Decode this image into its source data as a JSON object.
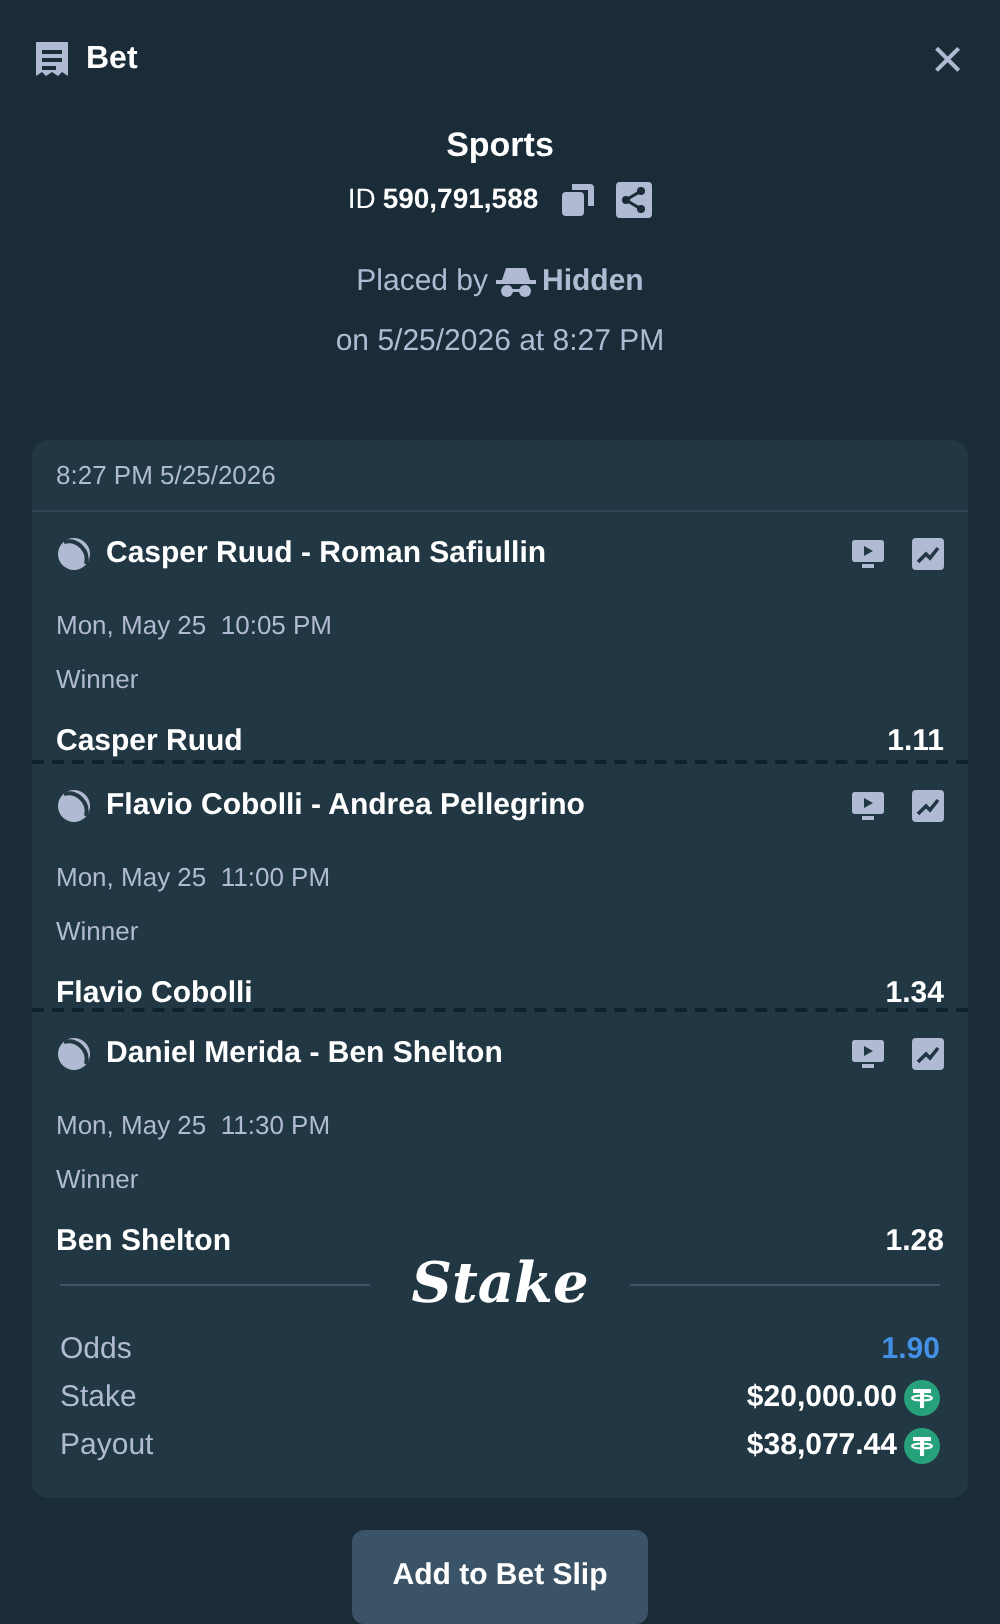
{
  "header": {
    "title": "Bet",
    "close": "×"
  },
  "bet": {
    "category": "Sports",
    "id_label": "ID",
    "id": "590,791,588",
    "placed_by_label": "Placed by",
    "placed_by": "Hidden",
    "placed_on": "on 5/25/2026 at 8:27 PM"
  },
  "slip": {
    "timestamp": "8:27 PM 5/25/2026",
    "legs": [
      {
        "match": "Casper Ruud - Roman Safiullin",
        "time": "Mon, May 25  10:05 PM",
        "market": "Winner",
        "selection": "Casper Ruud",
        "odds": "1.11"
      },
      {
        "match": "Flavio Cobolli - Andrea Pellegrino",
        "time": "Mon, May 25  11:00 PM",
        "market": "Winner",
        "selection": "Flavio Cobolli",
        "odds": "1.34"
      },
      {
        "match": "Daniel Merida - Ben Shelton",
        "time": "Mon, May 25  11:30 PM",
        "market": "Winner",
        "selection": "Ben Shelton",
        "odds": "1.28"
      }
    ],
    "brand": "Stake",
    "summary": [
      {
        "kind": "odds",
        "label": "Odds",
        "value": "1.90"
      },
      {
        "kind": "amount",
        "label": "Stake",
        "value": "$20,000.00"
      },
      {
        "kind": "amount",
        "label": "Payout",
        "value": "$38,077.44"
      }
    ]
  },
  "button": "Add to Bet Slip"
}
